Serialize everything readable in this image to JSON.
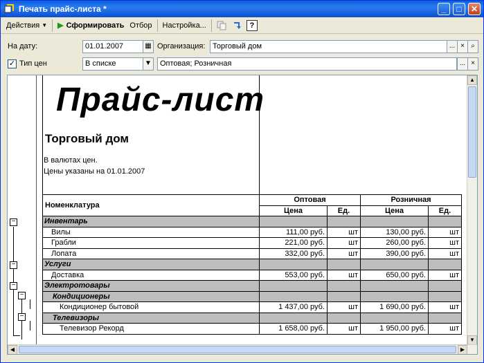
{
  "window": {
    "title": "Печать прайс-листа *",
    "controls": [
      "minimize-icon",
      "maximize-icon",
      "close-icon"
    ]
  },
  "toolbar": {
    "actions_label": "Действия",
    "generate_label": "Сформировать",
    "select_label": "Отбор",
    "settings_label": "Настройка...",
    "help_label": "?"
  },
  "form": {
    "date_label": "На дату:",
    "date_value": "01.01.2007",
    "org_label": "Организация:",
    "org_value": "Торговый дом",
    "price_type_label": "Тип цен",
    "price_type_checked": true,
    "price_type_mode": "В списке",
    "price_type_value": "Оптовая; Розничная",
    "more_btn": "...",
    "clear_btn": "×"
  },
  "report": {
    "title": "Прайс-лист",
    "organization": "Торговый дом",
    "note1": "В валютах цен.",
    "note2": "Цены указаны на 01.01.2007",
    "header_item": "Номенклатура",
    "header_wholesale": "Оптовая",
    "header_retail": "Розничная",
    "header_price": "Цена",
    "header_unit": "Ед.",
    "rows": [
      {
        "type": "group",
        "name": "Инвентарь"
      },
      {
        "type": "item",
        "name": "Вилы",
        "w_price": "111,00 руб.",
        "w_unit": "шт",
        "r_price": "130,00 руб.",
        "r_unit": "шт"
      },
      {
        "type": "item",
        "name": "Грабли",
        "w_price": "221,00 руб.",
        "w_unit": "шт",
        "r_price": "260,00 руб.",
        "r_unit": "шт"
      },
      {
        "type": "item",
        "name": "Лопата",
        "w_price": "332,00 руб.",
        "w_unit": "шт",
        "r_price": "390,00 руб.",
        "r_unit": "шт"
      },
      {
        "type": "group",
        "name": "Услуги"
      },
      {
        "type": "item",
        "name": "Доставка",
        "w_price": "553,00 руб.",
        "w_unit": "шт",
        "r_price": "650,00 руб.",
        "r_unit": "шт"
      },
      {
        "type": "group",
        "name": "Электротовары"
      },
      {
        "type": "subgroup",
        "name": "Кондиционеры"
      },
      {
        "type": "subitem",
        "name": "Кондиционер бытовой",
        "w_price": "1 437,00 руб.",
        "w_unit": "шт",
        "r_price": "1 690,00 руб.",
        "r_unit": "шт"
      },
      {
        "type": "subgroup",
        "name": "Телевизоры"
      },
      {
        "type": "subitem",
        "name": "Телевизор Рекорд",
        "w_price": "1 658,00 руб.",
        "w_unit": "шт",
        "r_price": "1 950,00 руб.",
        "r_unit": "шт"
      }
    ]
  }
}
